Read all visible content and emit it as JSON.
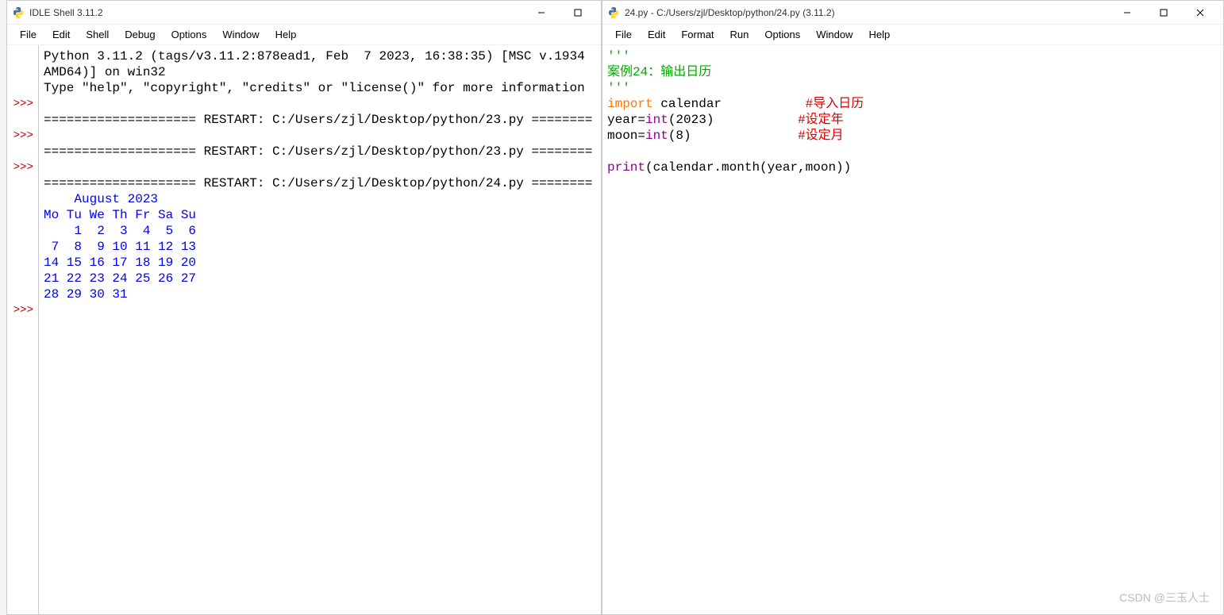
{
  "shell_window": {
    "title": "IDLE Shell 3.11.2",
    "menus": [
      "File",
      "Edit",
      "Shell",
      "Debug",
      "Options",
      "Window",
      "Help"
    ],
    "gutter_prompts": [
      ">>>",
      "",
      ">>>",
      "",
      ">>>",
      "",
      "",
      "",
      "",
      "",
      "",
      "",
      "",
      "",
      ">>>"
    ],
    "intro_line1": "Python 3.11.2 (tags/v3.11.2:878ead1, Feb  7 2023, 16:38:35) [MSC v.1934",
    "intro_line2": "AMD64)] on win32",
    "intro_line3": "Type \"help\", \"copyright\", \"credits\" or \"license()\" for more information",
    "restart1": "==================== RESTART: C:/Users/zjl/Desktop/python/23.py ========",
    "restart2": "==================== RESTART: C:/Users/zjl/Desktop/python/23.py ========",
    "restart3": "==================== RESTART: C:/Users/zjl/Desktop/python/24.py ========",
    "cal_title": "    August 2023",
    "cal_head": "Mo Tu We Th Fr Sa Su",
    "cal_r1": "    1  2  3  4  5  6",
    "cal_r2": " 7  8  9 10 11 12 13",
    "cal_r3": "14 15 16 17 18 19 20",
    "cal_r4": "21 22 23 24 25 26 27",
    "cal_r5": "28 29 30 31"
  },
  "editor_window": {
    "title": "24.py - C:/Users/zjl/Desktop/python/24.py (3.11.2)",
    "menus": [
      "File",
      "Edit",
      "Format",
      "Run",
      "Options",
      "Window",
      "Help"
    ],
    "docstr_open": "'''",
    "docstr_body": "案例24：输出日历",
    "docstr_close": "'''",
    "kw_import": "import",
    "mod_cal": " calendar",
    "pad_import": "           ",
    "com_import": "#导入日历",
    "y_lhs": "year=",
    "int_fn": "int",
    "y_arg": "(2023)",
    "pad_year": "           ",
    "com_year": "#设定年",
    "m_lhs": "moon=",
    "m_arg": "(8)",
    "pad_moon": "              ",
    "com_moon": "#设定月",
    "print_fn": "print",
    "print_args": "(calendar.month(year,moon))"
  },
  "watermark": "CSDN @三玉人士"
}
